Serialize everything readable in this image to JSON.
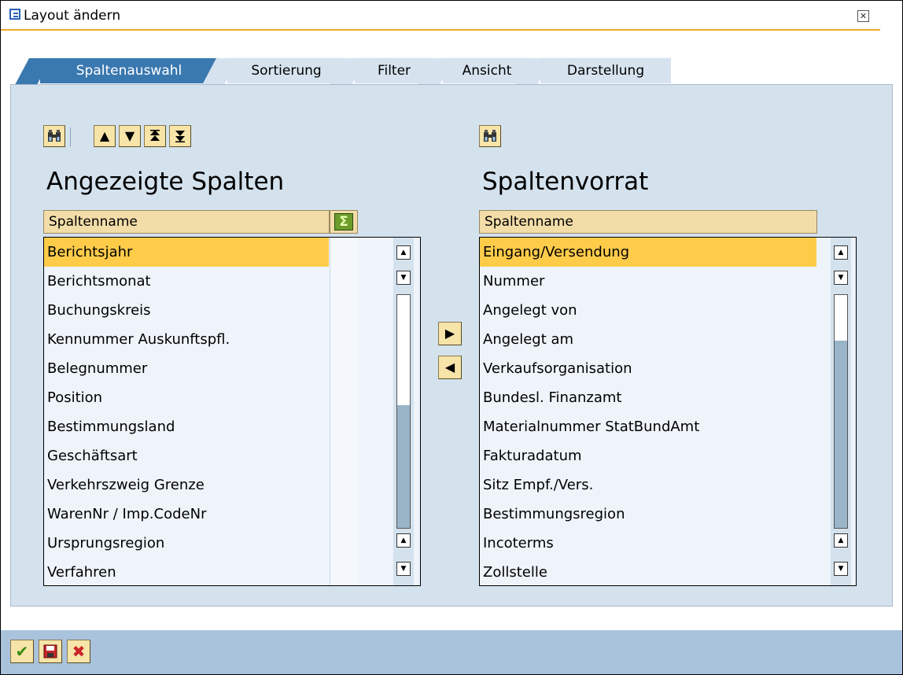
{
  "window": {
    "title": "Layout ändern",
    "close_label": "✕"
  },
  "tabs": [
    {
      "label": "Spaltenauswahl",
      "active": true
    },
    {
      "label": "Sortierung",
      "active": false
    },
    {
      "label": "Filter",
      "active": false
    },
    {
      "label": "Ansicht",
      "active": false
    },
    {
      "label": "Darstellung",
      "active": false
    }
  ],
  "left": {
    "heading": "Angezeigte Spalten",
    "column_header": "Spaltenname",
    "sum_icon": "sigma-icon",
    "toolbar_icons": [
      "find-icon",
      "up-icon",
      "down-icon",
      "top-icon",
      "bottom-icon"
    ],
    "rows": [
      "Berichtsjahr",
      "Berichtsmonat",
      "Buchungskreis",
      "Kennummer Auskunftspfl.",
      "Belegnummer",
      "Position",
      "Bestimmungsland",
      "Geschäftsart",
      "Verkehrszweig Grenze",
      "WarenNr / Imp.CodeNr",
      "Ursprungsregion",
      "Verfahren"
    ],
    "selected_index": 0
  },
  "right": {
    "heading": "Spaltenvorrat",
    "column_header": "Spaltenname",
    "toolbar_icons": [
      "find-icon"
    ],
    "rows": [
      "Eingang/Versendung",
      "Nummer",
      "Angelegt von",
      "Angelegt am",
      "Verkaufsorganisation",
      "Bundesl. Finanzamt",
      "Materialnummer StatBundAmt",
      "Fakturadatum",
      "Sitz Empf./Vers.",
      "Bestimmungsregion",
      "Incoterms",
      "Zollstelle"
    ],
    "selected_index": 0
  },
  "middle_buttons": [
    "move-right-icon",
    "move-left-icon"
  ],
  "footer": {
    "buttons": [
      "confirm-icon",
      "save-icon",
      "cancel-icon"
    ]
  },
  "colors": {
    "tab_active": "#3a78b0",
    "selection": "#ffcc4a",
    "panel": "#d4e2ee",
    "footer": "#a9c3dd"
  }
}
